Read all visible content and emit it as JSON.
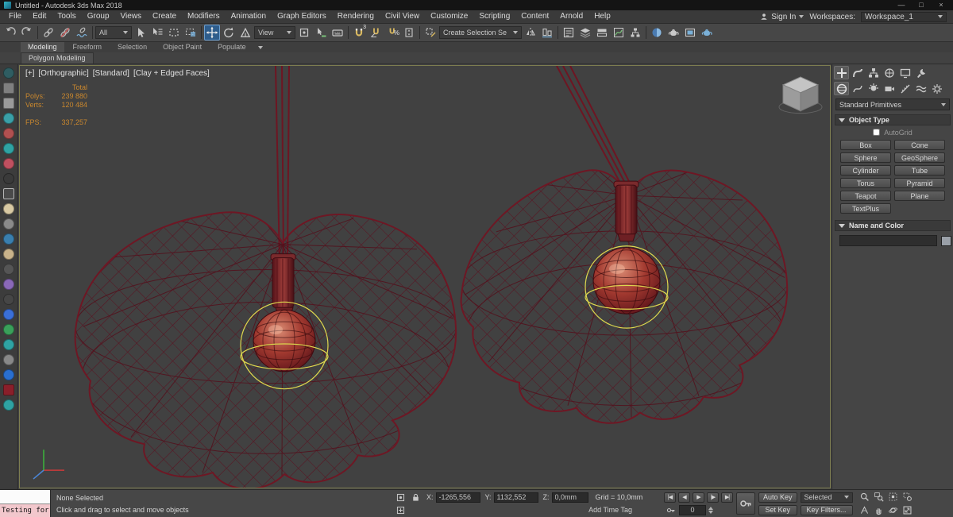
{
  "window": {
    "title": "Untitled - Autodesk 3ds Max 2018",
    "minimize": "—",
    "maximize": "□",
    "close": "×"
  },
  "menu": {
    "items": [
      "File",
      "Edit",
      "Tools",
      "Group",
      "Views",
      "Create",
      "Modifiers",
      "Animation",
      "Graph Editors",
      "Rendering",
      "Civil View",
      "Customize",
      "Scripting",
      "Content",
      "Arnold",
      "Help"
    ],
    "sign_in": "Sign In",
    "workspaces_label": "Workspaces:",
    "workspace_value": "Workspace_1"
  },
  "toolbar": {
    "selection_filter_value": "All",
    "coord_system_value": "View",
    "selection_set_placeholder": "Create Selection Se",
    "snap_value": "3",
    "percent_glyph": "%"
  },
  "ribbon": {
    "tabs": [
      "Modeling",
      "Freeform",
      "Selection",
      "Object Paint",
      "Populate"
    ],
    "subtab": "Polygon Modeling"
  },
  "viewport": {
    "label_general": "[+]",
    "label_pov": "[Orthographic]",
    "label_standard": "[Standard]",
    "label_shading": "[Clay + Edged Faces]",
    "stats": {
      "total_label": "Total",
      "polys_label": "Polys:",
      "polys_value": "239 880",
      "verts_label": "Verts:",
      "verts_value": "120 484",
      "fps_label": "FPS:",
      "fps_value": "337,257"
    },
    "colors": {
      "background": "#414141",
      "wireframe": "#5a1220",
      "bulb": "#a33a30",
      "selection": "#ded84e"
    }
  },
  "command_panel": {
    "category_dropdown": "Standard Primitives",
    "object_type_label": "Object Type",
    "autogrid_label": "AutoGrid",
    "object_buttons": [
      "Box",
      "Cone",
      "Sphere",
      "GeoSphere",
      "Cylinder",
      "Tube",
      "Torus",
      "Pyramid",
      "Teapot",
      "Plane",
      "TextPlus"
    ],
    "name_color_label": "Name and Color"
  },
  "status_bar": {
    "listener_text": "Testing for i",
    "selection_status": "None Selected",
    "prompt": "Click and drag to select and move objects",
    "x_label": "X:",
    "x_value": "-1265,556",
    "y_label": "Y:",
    "y_value": "1132,552",
    "z_label": "Z:",
    "z_value": "0,0mm",
    "grid_label": "Grid = 10,0mm",
    "add_time_tag": "Add Time Tag",
    "playback": [
      "|◀",
      "◀",
      "▶",
      "|▶",
      "▶|"
    ],
    "frame_value": "0",
    "auto_key": "Auto Key",
    "set_key": "Set Key",
    "key_mode_dropdown": "Selected",
    "key_filters": "Key Filters..."
  }
}
